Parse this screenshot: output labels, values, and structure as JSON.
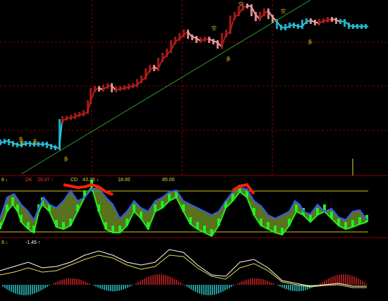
{
  "chart_data": [
    {
      "type": "line",
      "panel": "price",
      "series": [
        {
          "values": [
            [
              0,
              203
            ],
            [
              6,
              201
            ],
            [
              12,
              200
            ],
            [
              18,
              203
            ],
            [
              24,
              205
            ],
            [
              30,
              206
            ],
            [
              36,
              204
            ],
            [
              42,
              203
            ],
            [
              48,
              205
            ],
            [
              54,
              204
            ],
            [
              60,
              205
            ],
            [
              66,
              204
            ],
            [
              72,
              207
            ],
            [
              78,
              209
            ],
            [
              84,
              210
            ],
            [
              88,
              172
            ],
            [
              94,
              168
            ],
            [
              100,
              167
            ],
            [
              106,
              166
            ],
            [
              112,
              163
            ],
            [
              118,
              162
            ],
            [
              124,
              159
            ],
            [
              128,
              145
            ],
            [
              134,
              128
            ],
            [
              140,
              125
            ],
            [
              146,
              127
            ],
            [
              152,
              123
            ],
            [
              158,
              121
            ],
            [
              164,
              128
            ],
            [
              170,
              126
            ],
            [
              176,
              125
            ],
            [
              182,
              124
            ],
            [
              188,
              122
            ],
            [
              194,
              121
            ],
            [
              200,
              115
            ],
            [
              206,
              110
            ],
            [
              212,
              100
            ],
            [
              218,
              95
            ],
            [
              224,
              98
            ],
            [
              230,
              85
            ],
            [
              236,
              78
            ],
            [
              242,
              72
            ],
            [
              248,
              60
            ],
            [
              254,
              55
            ],
            [
              260,
              50
            ],
            [
              266,
              45
            ],
            [
              272,
              52
            ],
            [
              278,
              54
            ],
            [
              284,
              58
            ],
            [
              290,
              56
            ],
            [
              296,
              55
            ],
            [
              302,
              58
            ],
            [
              308,
              60
            ],
            [
              314,
              66
            ],
            [
              320,
              50
            ],
            [
              326,
              45
            ],
            [
              332,
              25
            ],
            [
              338,
              20
            ],
            [
              344,
              12
            ],
            [
              350,
              8
            ],
            [
              356,
              9
            ],
            [
              362,
              20
            ],
            [
              368,
              27
            ],
            [
              374,
              20
            ],
            [
              380,
              15
            ],
            [
              386,
              24
            ],
            [
              392,
              30
            ],
            [
              398,
              38
            ],
            [
              404,
              40
            ],
            [
              410,
              37
            ],
            [
              416,
              35
            ],
            [
              422,
              37
            ],
            [
              428,
              38
            ],
            [
              434,
              31
            ],
            [
              440,
              29
            ],
            [
              446,
              31
            ],
            [
              452,
              33
            ],
            [
              458,
              30
            ],
            [
              464,
              29
            ],
            [
              470,
              27
            ],
            [
              476,
              28
            ],
            [
              482,
              31
            ],
            [
              488,
              30
            ],
            [
              494,
              35
            ],
            [
              500,
              38
            ],
            [
              506,
              37
            ],
            [
              512,
              38
            ],
            [
              518,
              37
            ],
            [
              522,
              38
            ]
          ]
        }
      ],
      "trendline": [
        [
          30,
          247
        ],
        [
          440,
          0
        ]
      ],
      "colors": {
        "up": "#b71c1c",
        "down": "#f4a0a0",
        "flat": "#26c6da",
        "trend": "#2e9e2e",
        "grid": "#8b0000",
        "signal": "#e0c020"
      },
      "annotations": [
        "空",
        "空",
        "多",
        "空",
        "多",
        "多",
        "多",
        "空",
        "多"
      ]
    },
    {
      "type": "area",
      "panel": "indicator-1",
      "labels": {
        "a": "8 ↓",
        "b": "DK",
        "c": "29.07 ↑",
        "d": "CD",
        "e": "43.25 ↓",
        "f": "18.00",
        "g": "85.00"
      },
      "levels": [
        18.0,
        85.0
      ],
      "series": [
        {
          "name": "blue",
          "values": [
            [
              0,
              310
            ],
            [
              10,
              280
            ],
            [
              20,
              275
            ],
            [
              30,
              290
            ],
            [
              40,
              300
            ],
            [
              48,
              312
            ],
            [
              55,
              295
            ],
            [
              62,
              280
            ],
            [
              70,
              290
            ],
            [
              80,
              295
            ],
            [
              90,
              285
            ],
            [
              100,
              270
            ],
            [
              110,
              285
            ],
            [
              120,
              280
            ],
            [
              130,
              268
            ],
            [
              140,
              266
            ],
            [
              150,
              280
            ],
            [
              160,
              290
            ],
            [
              170,
              310
            ],
            [
              180,
              300
            ],
            [
              190,
              285
            ],
            [
              200,
              295
            ],
            [
              210,
              300
            ],
            [
              220,
              285
            ],
            [
              230,
              280
            ],
            [
              240,
              272
            ],
            [
              250,
              270
            ],
            [
              260,
              285
            ],
            [
              270,
              290
            ],
            [
              280,
              295
            ],
            [
              290,
              300
            ],
            [
              300,
              305
            ],
            [
              310,
              300
            ],
            [
              320,
              285
            ],
            [
              330,
              272
            ],
            [
              340,
              266
            ],
            [
              350,
              268
            ],
            [
              360,
              285
            ],
            [
              370,
              292
            ],
            [
              380,
              305
            ],
            [
              390,
              310
            ],
            [
              400,
              305
            ],
            [
              410,
              300
            ],
            [
              418,
              285
            ],
            [
              425,
              290
            ],
            [
              430,
              300
            ],
            [
              440,
              304
            ],
            [
              450,
              290
            ],
            [
              460,
              300
            ],
            [
              470,
              296
            ],
            [
              480,
              308
            ],
            [
              490,
              312
            ],
            [
              500,
              300
            ],
            [
              510,
              298
            ],
            [
              520,
              312
            ]
          ]
        },
        {
          "name": "green",
          "values": [
            [
              0,
              325
            ],
            [
              10,
              300
            ],
            [
              18,
              290
            ],
            [
              25,
              300
            ],
            [
              30,
              315
            ],
            [
              40,
              325
            ],
            [
              48,
              330
            ],
            [
              55,
              300
            ],
            [
              60,
              290
            ],
            [
              70,
              300
            ],
            [
              80,
              322
            ],
            [
              90,
              325
            ],
            [
              100,
              320
            ],
            [
              110,
              300
            ],
            [
              120,
              280
            ],
            [
              130,
              265
            ],
            [
              140,
              300
            ],
            [
              150,
              325
            ],
            [
              160,
              330
            ],
            [
              170,
              330
            ],
            [
              180,
              320
            ],
            [
              190,
              300
            ],
            [
              200,
              310
            ],
            [
              210,
              325
            ],
            [
              220,
              300
            ],
            [
              230,
              295
            ],
            [
              240,
              285
            ],
            [
              250,
              280
            ],
            [
              260,
              300
            ],
            [
              270,
              318
            ],
            [
              280,
              325
            ],
            [
              290,
              330
            ],
            [
              300,
              335
            ],
            [
              310,
              320
            ],
            [
              320,
              295
            ],
            [
              330,
              285
            ],
            [
              340,
              272
            ],
            [
              350,
              280
            ],
            [
              360,
              305
            ],
            [
              370,
              320
            ],
            [
              380,
              325
            ],
            [
              390,
              330
            ],
            [
              400,
              333
            ],
            [
              410,
              320
            ],
            [
              420,
              300
            ],
            [
              430,
              305
            ],
            [
              440,
              315
            ],
            [
              450,
              305
            ],
            [
              460,
              300
            ],
            [
              470,
              310
            ],
            [
              480,
              320
            ],
            [
              490,
              325
            ],
            [
              500,
              322
            ],
            [
              510,
              318
            ],
            [
              520,
              315
            ]
          ]
        },
        {
          "name": "red",
          "values": [
            [
              90,
              262
            ],
            [
              100,
              264
            ],
            [
              110,
              266
            ],
            [
              120,
              265
            ],
            [
              130,
              262
            ],
            [
              140,
              265
            ],
            [
              150,
              272
            ],
            [
              160,
              276
            ],
            [
              330,
              270
            ],
            [
              340,
              264
            ],
            [
              350,
              262
            ],
            [
              360,
              275
            ]
          ]
        }
      ],
      "colors": {
        "blue": "#3355ff",
        "green": "#22ee22",
        "red": "#ff2200",
        "olive": "#6f8f24",
        "level": "#d6c600"
      }
    },
    {
      "type": "bar",
      "panel": "indicator-2",
      "labels": {
        "a": "9 ↓",
        "b": "-1.45 ↑"
      },
      "histogram_zero": 404,
      "lines": [
        {
          "name": "white",
          "values": [
            [
              0,
              384
            ],
            [
              20,
              378
            ],
            [
              40,
              372
            ],
            [
              60,
              380
            ],
            [
              80,
              378
            ],
            [
              100,
              372
            ],
            [
              120,
              362
            ],
            [
              140,
              356
            ],
            [
              160,
              362
            ],
            [
              180,
              372
            ],
            [
              200,
              376
            ],
            [
              220,
              372
            ],
            [
              240,
              354
            ],
            [
              260,
              358
            ],
            [
              280,
              376
            ],
            [
              300,
              390
            ],
            [
              320,
              392
            ],
            [
              340,
              372
            ],
            [
              360,
              368
            ],
            [
              380,
              380
            ],
            [
              400,
              398
            ],
            [
              420,
              402
            ],
            [
              440,
              406
            ],
            [
              460,
              404
            ],
            [
              480,
              402
            ],
            [
              500,
              406
            ],
            [
              520,
              406
            ]
          ]
        },
        {
          "name": "yellow",
          "values": [
            [
              0,
              390
            ],
            [
              20,
              386
            ],
            [
              40,
              380
            ],
            [
              60,
              386
            ],
            [
              80,
              384
            ],
            [
              100,
              376
            ],
            [
              120,
              368
            ],
            [
              140,
              362
            ],
            [
              160,
              366
            ],
            [
              180,
              376
            ],
            [
              200,
              382
            ],
            [
              220,
              378
            ],
            [
              240,
              362
            ],
            [
              260,
              364
            ],
            [
              280,
              380
            ],
            [
              300,
              392
            ],
            [
              320,
              396
            ],
            [
              340,
              380
            ],
            [
              360,
              374
            ],
            [
              380,
              384
            ],
            [
              400,
              400
            ],
            [
              420,
              404
            ],
            [
              440,
              407
            ],
            [
              460,
              405
            ],
            [
              480,
              404
            ],
            [
              500,
              408
            ],
            [
              520,
              408
            ]
          ]
        }
      ],
      "colors": {
        "pos": "#cc2222",
        "neg": "#33cccc",
        "white": "#ffffff",
        "yellow": "#e6d84a"
      }
    }
  ]
}
